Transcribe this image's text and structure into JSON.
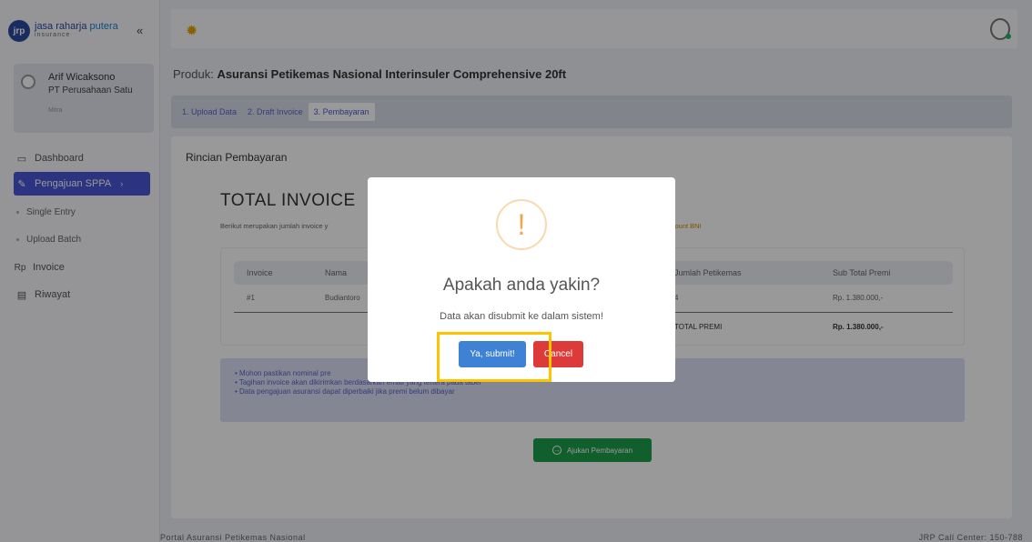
{
  "brand": {
    "name_a": "jasa raharja",
    "name_b": "putera",
    "sub": "insurance",
    "collapse_icon": "chevrons-left-icon"
  },
  "user": {
    "name": "Arif Wicaksono",
    "company": "PT Perusahaan Satu",
    "role": "Mitra"
  },
  "nav": [
    {
      "label": "Dashboard",
      "icon": "monitor-icon"
    },
    {
      "label": "Pengajuan SPPA",
      "icon": "pencil-icon",
      "active": true
    },
    {
      "label": "Invoice",
      "icon": "rupiah-icon"
    },
    {
      "label": "Riwayat",
      "icon": "document-icon"
    }
  ],
  "nav_sub": [
    "Single Entry",
    "Upload Batch"
  ],
  "nav_icon_text": {
    "invoice": "Rp"
  },
  "product": {
    "prefix": "Produk:",
    "name": "Asuransi Petikemas Nasional Interinsuler Comprehensive 20ft"
  },
  "steps": [
    "1. Upload Data",
    "2. Draft Invoice",
    "3. Pembayaran"
  ],
  "panel": {
    "title": "Rincian Pembayaran",
    "total_invoice": "TOTAL INVOICE",
    "desc": "Berikut merupakan jumlah invoice y",
    "desc_right": "ccount BNI"
  },
  "table": {
    "headers": [
      "Invoice",
      "Nama",
      "Jumlah Petikemas",
      "Sub Total Premi"
    ],
    "row": [
      "#1",
      "Budiantoro",
      "4",
      "Rp. 1.380.000,-"
    ],
    "total_label": "TOTAL PREMI",
    "total_value": "Rp. 1.380.000,-"
  },
  "notes": [
    "Mohon pastikan nominal pre",
    "Tagihan invoice akan dikirimkan berdasarkan email yang tertera pada tabel",
    "Data pengajuan asuransi dapat diperbaiki jika premi belum dibayar"
  ],
  "ajukan_button": "Ajukan Pembayaran",
  "footer": {
    "left": "Portal Asuransi Petikemas Nasional",
    "right": "JRP Call Center: 150-788"
  },
  "modal": {
    "icon": "!",
    "title": "Apakah anda yakin?",
    "text": "Data akan disubmit ke dalam sistem!",
    "confirm": "Ya, submit!",
    "cancel": "Cancel"
  },
  "colors": {
    "primary": "#4a56d6",
    "confirm": "#3d82d5",
    "cancel": "#dd3a3a",
    "success": "#1f9e4d",
    "highlight": "#ffc400"
  }
}
